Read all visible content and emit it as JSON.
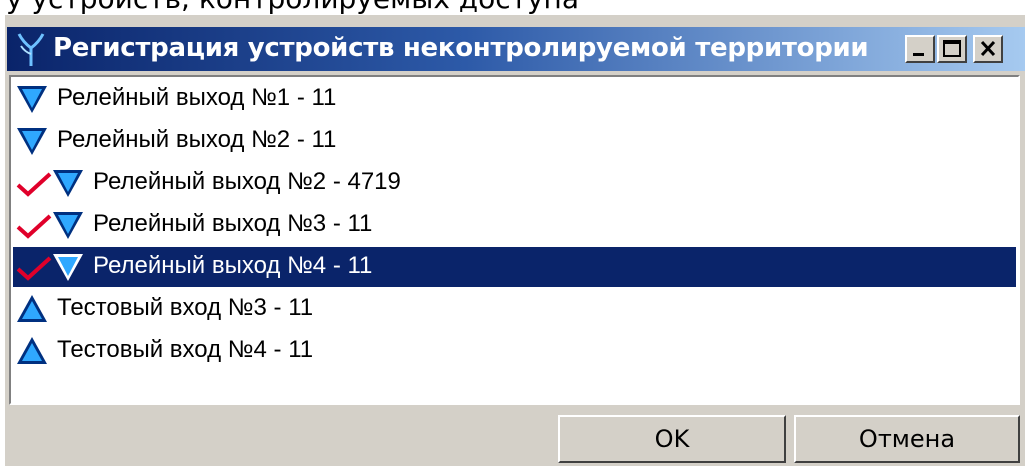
{
  "window": {
    "title": "Регистрация устройств неконтролируемой территории",
    "controls": [
      "minimize-icon",
      "maximize-icon",
      "close-icon"
    ],
    "titlebar_color_start": "#0a246a",
    "titlebar_color_end": "#a6caf0"
  },
  "list": {
    "items": [
      {
        "label": "Релейный выход №1 - 11",
        "icon": "relay-output-icon",
        "checked": false,
        "selected": false
      },
      {
        "label": "Релейный выход №2 - 11",
        "icon": "relay-output-icon",
        "checked": false,
        "selected": false
      },
      {
        "label": "Релейный выход №2 - 4719",
        "icon": "relay-output-icon",
        "checked": true,
        "selected": false
      },
      {
        "label": "Релейный выход №3 - 11",
        "icon": "relay-output-icon",
        "checked": true,
        "selected": false
      },
      {
        "label": "Релейный выход №4 - 11",
        "icon": "relay-output-icon",
        "checked": true,
        "selected": true
      },
      {
        "label": "Тестовый вход №3 - 11",
        "icon": "test-input-icon",
        "checked": false,
        "selected": false
      },
      {
        "label": "Тестовый вход №4 - 11",
        "icon": "test-input-icon",
        "checked": false,
        "selected": false
      }
    ],
    "selection_color": "#0a246a",
    "check_color": "#e0002a"
  },
  "buttons": {
    "ok_label": "OK",
    "cancel_label": "Отмена"
  }
}
